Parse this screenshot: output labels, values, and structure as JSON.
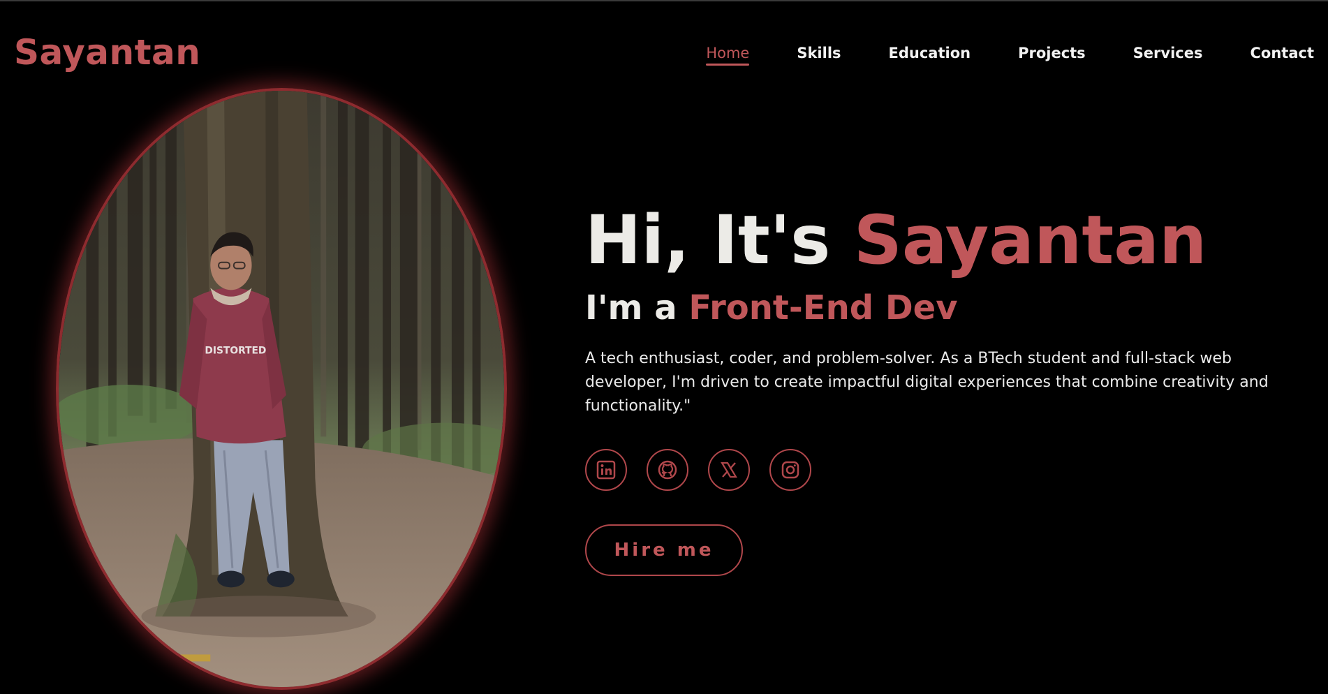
{
  "header": {
    "brand": "Sayantan",
    "nav": [
      {
        "label": "Home",
        "active": true
      },
      {
        "label": "Skills"
      },
      {
        "label": "Education"
      },
      {
        "label": "Projects"
      },
      {
        "label": "Services"
      },
      {
        "label": "Contact"
      }
    ]
  },
  "hero": {
    "greeting_prefix": "Hi, It's ",
    "greeting_name": "Sayantan",
    "role_prefix": "I'm a ",
    "role": "Front-End Dev",
    "description": "A tech enthusiast, coder, and problem-solver. As a BTech student and full-stack web developer, I'm driven to create impactful digital experiences that combine creativity and functionality.\"",
    "socials": [
      {
        "icon": "linkedin-icon"
      },
      {
        "icon": "github-icon"
      },
      {
        "icon": "x-twitter-icon"
      },
      {
        "icon": "instagram-icon"
      }
    ],
    "cta_label": "Hire me",
    "portrait": {
      "shirt_text": "DISTORTED"
    }
  },
  "colors": {
    "accent": "#c0575a",
    "background": "#000000",
    "text": "#ecebe7"
  }
}
